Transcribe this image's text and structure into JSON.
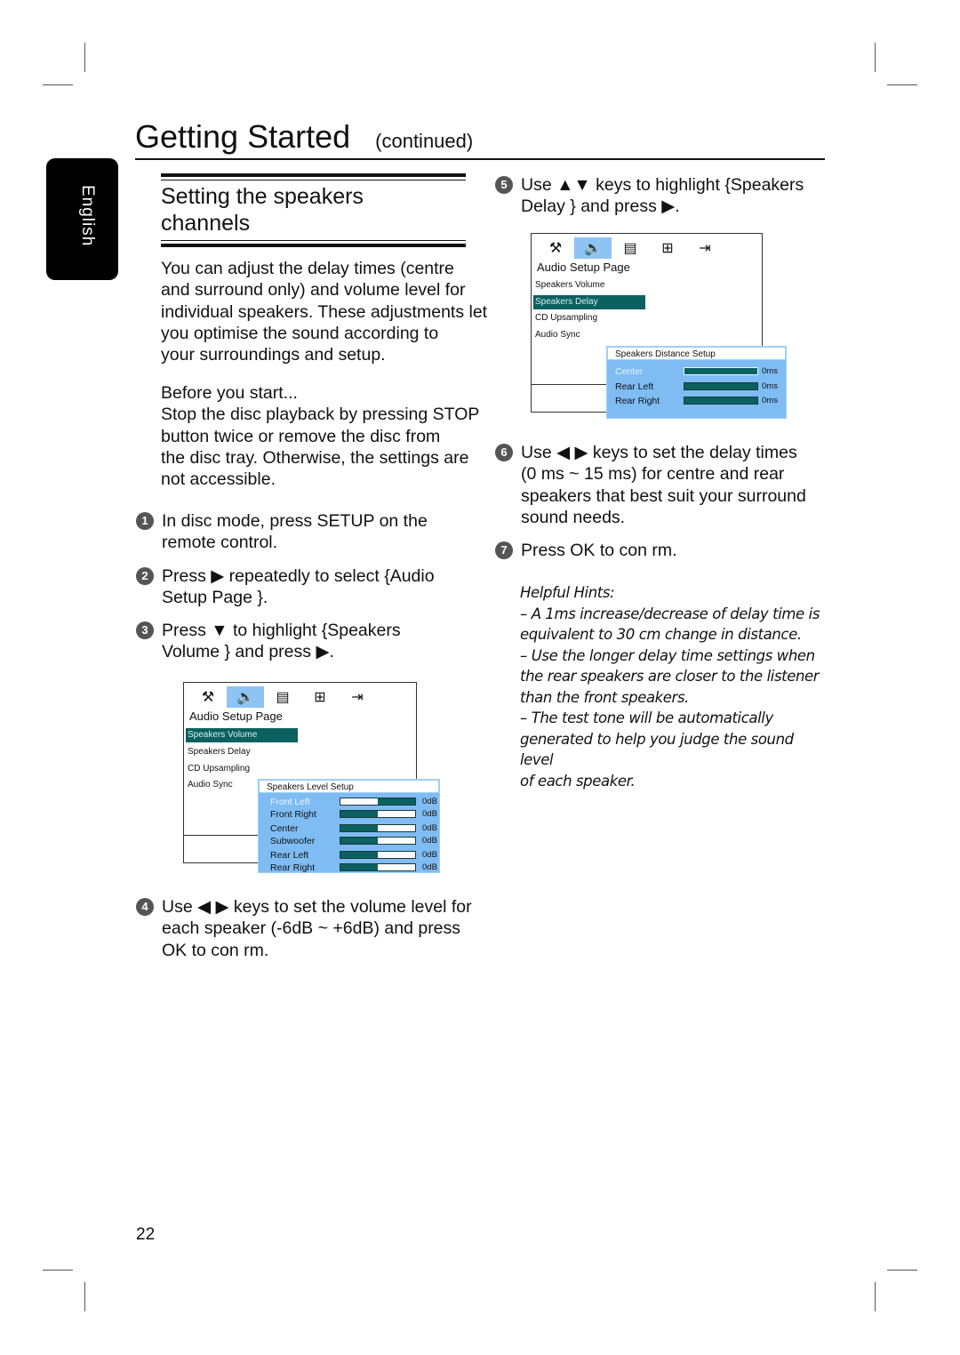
{
  "header": {
    "title": "Getting Started",
    "continued": "(continued)"
  },
  "side_tab": {
    "label": "English"
  },
  "section": {
    "title_line1": "Setting the speakers",
    "title_line2": "channels"
  },
  "intro": {
    "lines": [
      "You can adjust the delay times (centre",
      "and surround only) and volume level for",
      "individual speakers. These adjustments let",
      "you optimise the sound according to",
      "your surroundings and setup."
    ]
  },
  "before": {
    "lines": [
      "Before you start...",
      "Stop the disc playback by pressing STOP",
      "button twice or remove the disc from",
      "the disc tray. Otherwise, the settings are",
      "not accessible."
    ]
  },
  "steps": [
    {
      "num": "1",
      "lines": [
        "In disc mode, press SETUP on the",
        "remote control."
      ]
    },
    {
      "num": "2",
      "lines": [
        "Press ▶ repeatedly to select {Audio",
        "Setup Page }."
      ]
    },
    {
      "num": "3",
      "lines": [
        "Press ▼ to highlight {Speakers",
        "Volume } and press ▶."
      ]
    },
    {
      "num": "4",
      "lines": [
        "Use ◀ ▶ keys to set the volume level for",
        "each speaker (-6dB ~ +6dB) and press",
        "OK to con rm."
      ]
    },
    {
      "num": "5",
      "lines": [
        "Use ▲▼ keys to highlight {Speakers",
        "Delay } and press ▶."
      ]
    },
    {
      "num": "6",
      "lines": [
        "Use ◀ ▶ keys to set the delay times",
        "(0 ms ~ 15 ms) for centre and rear",
        "speakers that best suit your surround",
        "sound needs."
      ]
    },
    {
      "num": "7",
      "lines": [
        "Press OK to con rm."
      ]
    }
  ],
  "osd_icons": [
    {
      "name": "general-setup-icon",
      "glyph": "⚒"
    },
    {
      "name": "audio-speaker-icon",
      "glyph": "🔈"
    },
    {
      "name": "video-film-icon",
      "glyph": "▤"
    },
    {
      "name": "preferences-grid-icon",
      "glyph": "⊞"
    },
    {
      "name": "exit-door-icon",
      "glyph": "⇥"
    }
  ],
  "osd_volume": {
    "heading": "Audio Setup Page",
    "items": [
      "Speakers Volume",
      "Speakers Delay",
      "CD Upsampling",
      "Audio Sync"
    ],
    "selected": "Speakers Volume",
    "panel_title": "Speakers Level Setup",
    "rows": [
      {
        "label": "Front Left",
        "value": "0dB",
        "level_db": 0,
        "highlighted": true
      },
      {
        "label": "Front Right",
        "value": "0dB",
        "level_db": 0
      },
      {
        "label": "Center",
        "value": "0dB",
        "level_db": 0
      },
      {
        "label": "Subwoofer",
        "value": "0dB",
        "level_db": 0
      },
      {
        "label": "Rear Left",
        "value": "0dB",
        "level_db": 0
      },
      {
        "label": "Rear Right",
        "value": "0dB",
        "level_db": 0
      }
    ]
  },
  "osd_delay": {
    "heading": "Audio Setup Page",
    "items": [
      "Speakers Volume",
      "Speakers Delay",
      "CD Upsampling",
      "Audio Sync"
    ],
    "selected": "Speakers Delay",
    "panel_title": "Speakers Distance Setup",
    "rows": [
      {
        "label": "Center",
        "value": "0ms",
        "highlighted": true
      },
      {
        "label": "Rear Left",
        "value": "0ms"
      },
      {
        "label": "Rear Right",
        "value": "0ms"
      }
    ]
  },
  "hints": {
    "title": "Helpful Hints:",
    "lines": [
      "– A 1ms increase/decrease of delay time is",
      "equivalent to 30 cm change in distance.",
      "– Use the longer delay time settings when",
      "the rear speakers are closer to the listener",
      "than the front speakers.",
      "– The test tone will be automatically",
      "generated to help you judge the sound level",
      "of each speaker."
    ]
  },
  "page_number": "22",
  "colors": {
    "highlight_teal": "#0b6060",
    "panel_blue": "#7fbcf4",
    "active_icon_blue": "#8ec4f4"
  }
}
